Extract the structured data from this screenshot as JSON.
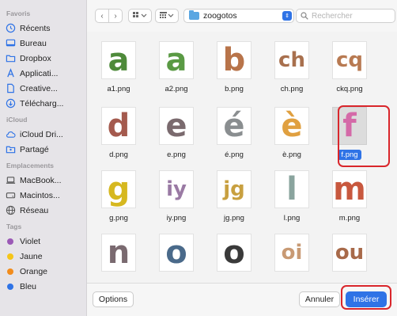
{
  "sidebar": {
    "sections": [
      {
        "title": "Favoris",
        "items": [
          {
            "label": "Récents",
            "icon": "clock-icon"
          },
          {
            "label": "Bureau",
            "icon": "desktop-icon"
          },
          {
            "label": "Dropbox",
            "icon": "folder-icon"
          },
          {
            "label": "Applicati...",
            "icon": "applications-icon"
          },
          {
            "label": "Creative...",
            "icon": "document-icon"
          },
          {
            "label": "Télécharg...",
            "icon": "download-icon"
          }
        ]
      },
      {
        "title": "iCloud",
        "items": [
          {
            "label": "iCloud Dri...",
            "icon": "cloud-icon"
          },
          {
            "label": "Partagé",
            "icon": "shared-folder-icon"
          }
        ]
      },
      {
        "title": "Emplacements",
        "items": [
          {
            "label": "MacBook...",
            "icon": "laptop-icon"
          },
          {
            "label": "Macintos...",
            "icon": "disk-icon"
          },
          {
            "label": "Réseau",
            "icon": "network-icon"
          }
        ]
      },
      {
        "title": "Tags",
        "items": [
          {
            "label": "Violet",
            "icon": "tag-dot",
            "color": "#9b59b6"
          },
          {
            "label": "Jaune",
            "icon": "tag-dot",
            "color": "#f5c518"
          },
          {
            "label": "Orange",
            "icon": "tag-dot",
            "color": "#f28c1c"
          },
          {
            "label": "Bleu",
            "icon": "tag-dot",
            "color": "#2f73e6"
          }
        ]
      }
    ]
  },
  "toolbar": {
    "back": "‹",
    "forward": "›",
    "folder": "zoogotos",
    "search_placeholder": "Rechercher"
  },
  "files": [
    {
      "name": "a1.png",
      "glyph": "a",
      "color": "#4e8a3a"
    },
    {
      "name": "a2.png",
      "glyph": "a",
      "color": "#5a9a44"
    },
    {
      "name": "b.png",
      "glyph": "b",
      "color": "#b8744a"
    },
    {
      "name": "ch.png",
      "glyph": "ch",
      "color": "#a8704e"
    },
    {
      "name": "ckq.png",
      "glyph": "cq",
      "color": "#b87a52"
    },
    {
      "name": "d.png",
      "glyph": "d",
      "color": "#a45a4e"
    },
    {
      "name": "e.png",
      "glyph": "e",
      "color": "#7a6a6e"
    },
    {
      "name": "é.png",
      "glyph": "é",
      "color": "#8a8e90"
    },
    {
      "name": "è.png",
      "glyph": "è",
      "color": "#e0a040"
    },
    {
      "name": "f.png",
      "glyph": "f",
      "color": "#d46aa8"
    },
    {
      "name": "g.png",
      "glyph": "g",
      "color": "#d6b820"
    },
    {
      "name": "iy.png",
      "glyph": "iy",
      "color": "#9a7aa4"
    },
    {
      "name": "jg.png",
      "glyph": "jg",
      "color": "#c8a040"
    },
    {
      "name": "l.png",
      "glyph": "l",
      "color": "#8aa49e"
    },
    {
      "name": "m.png",
      "glyph": "m",
      "color": "#c8583e"
    },
    {
      "name": "",
      "glyph": "n",
      "color": "#7a6a70"
    },
    {
      "name": "",
      "glyph": "o",
      "color": "#4a6a8a"
    },
    {
      "name": "",
      "glyph": "o",
      "color": "#3a3a3a"
    },
    {
      "name": "",
      "glyph": "oi",
      "color": "#c89a74"
    },
    {
      "name": "",
      "glyph": "ou",
      "color": "#a86a4a"
    }
  ],
  "selected_file": "f.png",
  "buttons": {
    "options": "Options",
    "cancel": "Annuler",
    "insert": "Insérer"
  }
}
